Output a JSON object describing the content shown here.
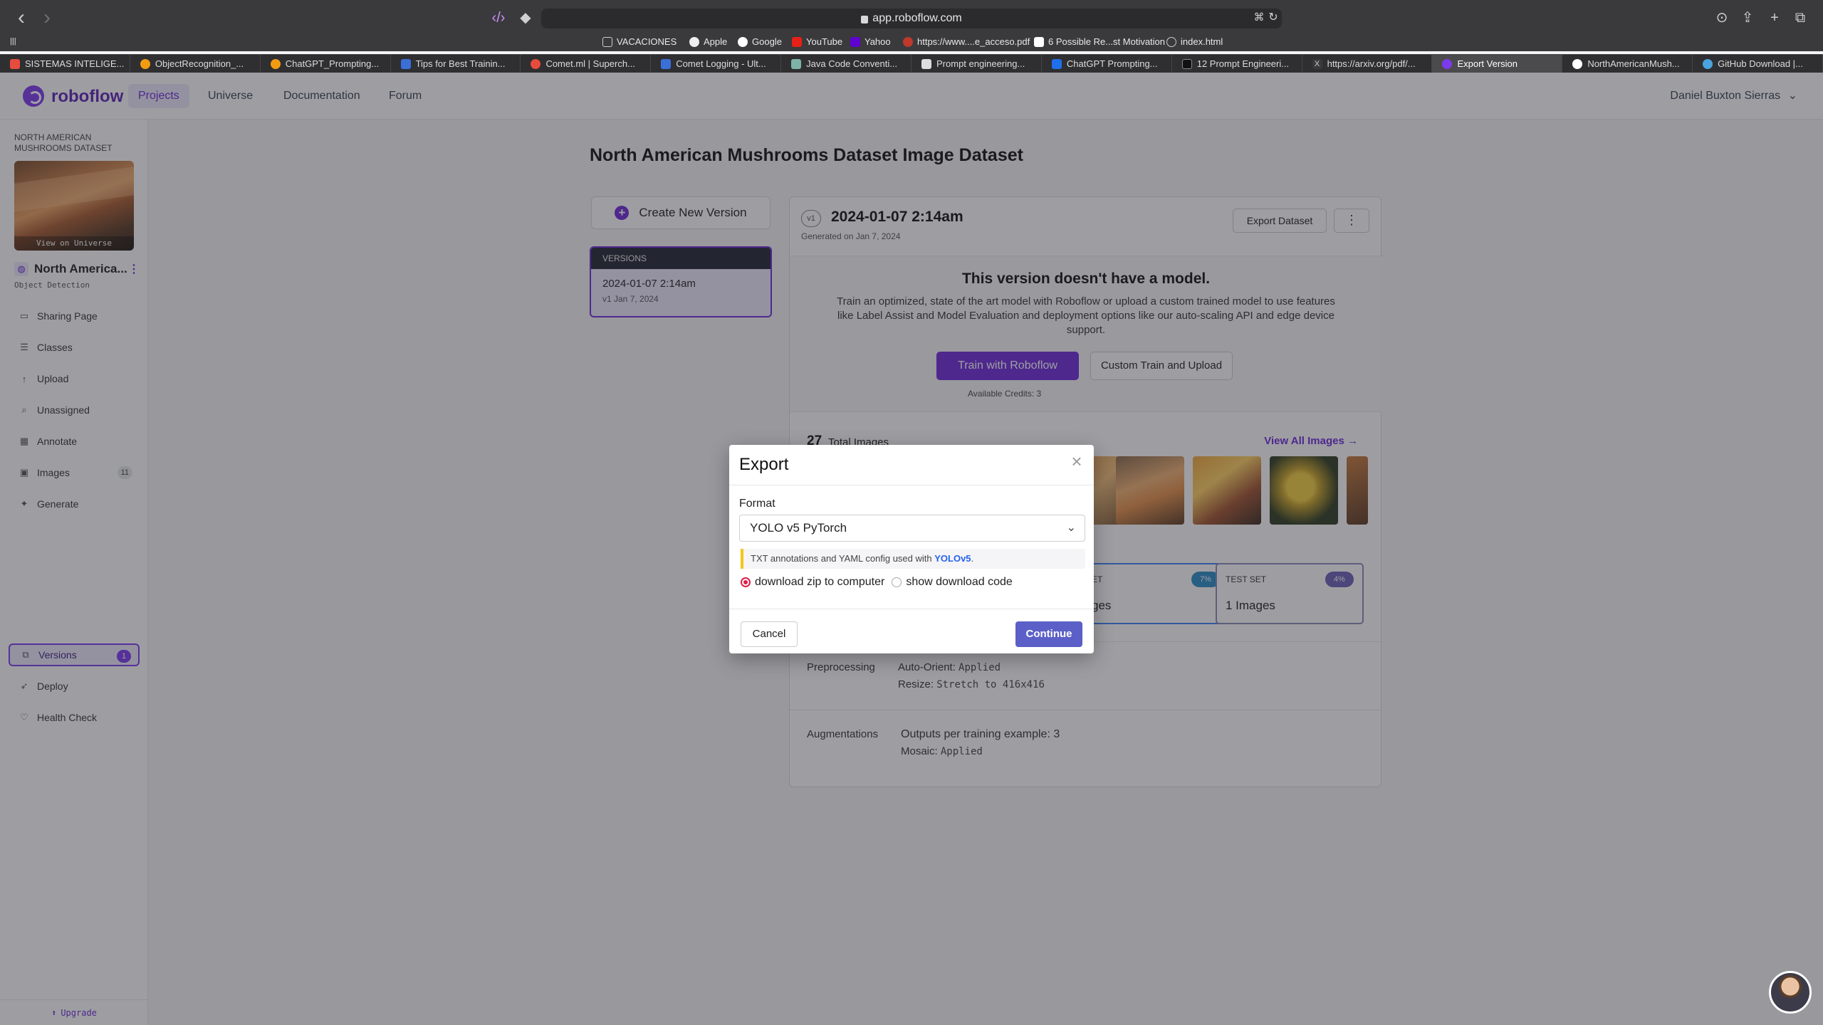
{
  "browser": {
    "url": "app.roboflow.com",
    "bookmarks": [
      "VACACIONES",
      "Apple",
      "Google",
      "YouTube",
      "Yahoo",
      "https://www....e_acceso.pdf",
      "6 Possible Re...st Motivation",
      "index.html"
    ],
    "tabs": [
      "SISTEMAS INTELIGE...",
      "ObjectRecognition_...",
      "ChatGPT_Prompting...",
      "Tips for Best Trainin...",
      "Comet.ml | Superch...",
      "Comet Logging - Ult...",
      "Java Code Conventi...",
      "Prompt engineering...",
      "ChatGPT Prompting...",
      "12 Prompt Engineeri...",
      "https://arxiv.org/pdf/...",
      "Export Version",
      "NorthAmericanMush...",
      "GitHub Download |..."
    ],
    "active_tab": 11
  },
  "header": {
    "logo": "roboflow",
    "nav": [
      "Projects",
      "Universe",
      "Documentation",
      "Forum"
    ],
    "user": "Daniel Buxton Sierras"
  },
  "sidebar": {
    "dataset_title": "NORTH AMERICAN MUSHROOMS DATASET",
    "thumb_caption": "View on Universe",
    "project_name": "North America...",
    "project_type": "Object Detection",
    "items": [
      {
        "label": "Sharing Page",
        "icon": "window-icon"
      },
      {
        "label": "Classes",
        "icon": "list-icon"
      },
      {
        "label": "Upload",
        "icon": "upload-icon"
      },
      {
        "label": "Unassigned",
        "icon": "search-icon"
      },
      {
        "label": "Annotate",
        "icon": "grid-icon"
      },
      {
        "label": "Images",
        "icon": "image-icon",
        "count": "11"
      },
      {
        "label": "Generate",
        "icon": "generate-icon"
      },
      {
        "label": "Versions",
        "icon": "versions-icon",
        "count": "1"
      },
      {
        "label": "Deploy",
        "icon": "rocket-icon"
      },
      {
        "label": "Health Check",
        "icon": "health-icon"
      }
    ],
    "upgrade": "Upgrade"
  },
  "main": {
    "page_title": "North American Mushrooms Dataset Image Dataset",
    "create_version": "Create New Version",
    "versions_header": "VERSIONS",
    "version_item": {
      "date": "2024-01-07 2:14am",
      "sub": "v1 Jan 7, 2024"
    },
    "card": {
      "badge": "v1",
      "title": "2024-01-07 2:14am",
      "generated": "Generated on Jan 7, 2024",
      "export_label": "Export Dataset",
      "no_model_title": "This version doesn't have a model.",
      "no_model_desc": "Train an optimized, state of the art model with Roboflow or upload a custom trained model to use features like Label Assist and Model Evaluation and deployment options like our auto-scaling API and edge device support.",
      "train_btn": "Train with Roboflow",
      "custom_btn": "Custom Train and Upload",
      "credits": "Available Credits:  3",
      "total_images_num": "27",
      "total_images_label": "Total Images",
      "view_all": "View All Images →",
      "valid_set": {
        "label": "ET",
        "pct": "7%",
        "count": "ges"
      },
      "test_set": {
        "label": "TEST SET",
        "pct": "4%",
        "count": "1 Images"
      },
      "preprocessing_label": "Preprocessing",
      "auto_orient_key": "Auto-Orient:",
      "auto_orient_val": "Applied",
      "resize_key": "Resize:",
      "resize_val": "Stretch to 416x416",
      "augmentations_label": "Augmentations",
      "outputs": "Outputs per training example: 3",
      "mosaic_key": "Mosaic:",
      "mosaic_val": "Applied"
    }
  },
  "modal": {
    "title": "Export",
    "format_label": "Format",
    "format_value": "YOLO v5 PyTorch",
    "note_text": "TXT annotations and YAML config used with ",
    "note_link": "YOLOv5",
    "note_end": ".",
    "radio_zip": "download zip to computer",
    "radio_code": "show download code",
    "selected": "zip",
    "cancel": "Cancel",
    "continue": "Continue"
  },
  "colors": {
    "accent": "#6d28d9",
    "continue": "#5b5fc7"
  }
}
